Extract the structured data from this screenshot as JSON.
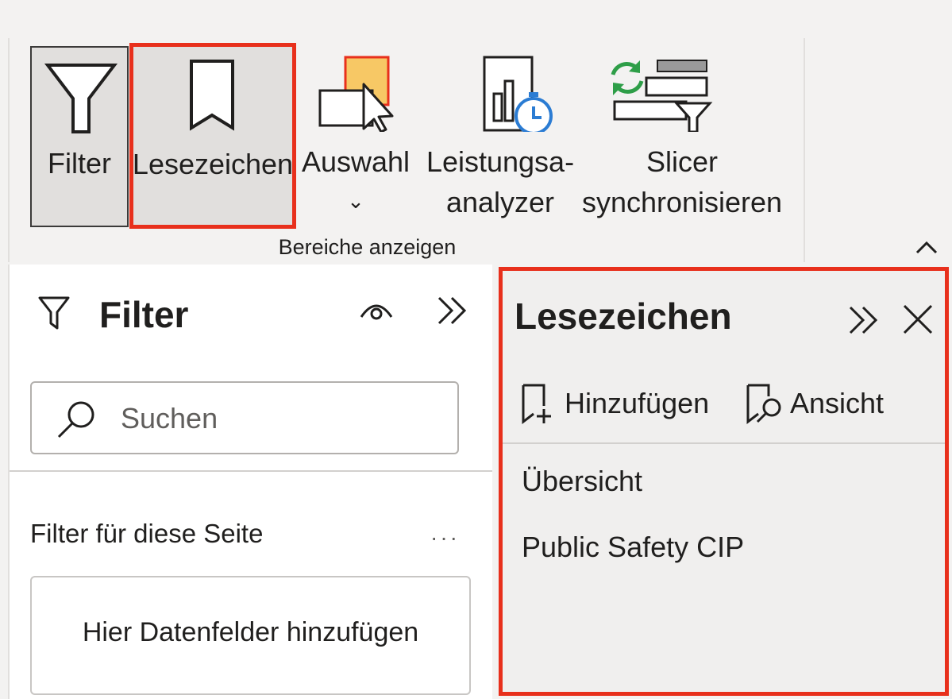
{
  "ribbon": {
    "buttons": {
      "filter": "Filter",
      "bookmark": "Lesezeichen",
      "selection": "Auswahl",
      "selection_chevron": "⌄",
      "performance_line1": "Leistungsa-",
      "performance_line2": "analyzer",
      "sync_line1": "Slicer",
      "sync_line2": "synchronisieren"
    },
    "group_label": "Bereiche anzeigen"
  },
  "filter_pane": {
    "title": "Filter",
    "search_placeholder": "Suchen",
    "page_filters_label": "Filter für diese Seite",
    "more": "···",
    "drop_zone": "Hier Datenfelder hinzufügen"
  },
  "bookmark_pane": {
    "title": "Lesezeichen",
    "add_label": "Hinzufügen",
    "view_label": "Ansicht",
    "items": [
      "Übersicht",
      "Public Safety CIP"
    ]
  },
  "colors": {
    "highlight": "#e8301c",
    "selected_bg": "#e1dfdd",
    "sync_green": "#2e9e48",
    "clock_blue": "#2b7cd3",
    "selection_yellow": "#f7c865"
  },
  "icons": [
    "funnel-icon",
    "bookmark-icon",
    "selection-icon",
    "performance-analyzer-icon",
    "sync-slicers-icon",
    "collapse-ribbon-icon",
    "filter-icon",
    "eye-icon",
    "expand-pane-icon",
    "search-icon",
    "more-icon",
    "close-icon",
    "add-bookmark-icon",
    "view-bookmark-icon"
  ]
}
